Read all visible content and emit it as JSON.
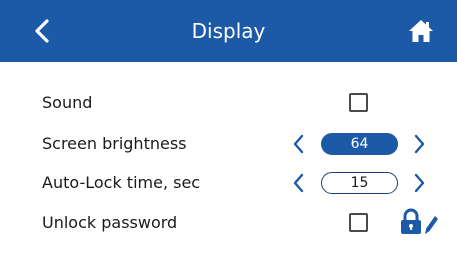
{
  "header": {
    "title": "Display",
    "back_icon": "chevron-left-icon",
    "home_icon": "home-icon"
  },
  "settings": {
    "sound": {
      "label": "Sound",
      "checked": false
    },
    "screen_brightness": {
      "label": "Screen brightness",
      "value": "64"
    },
    "auto_lock": {
      "label": "Auto-Lock time, sec",
      "value": "15"
    },
    "unlock_password": {
      "label": "Unlock password",
      "checked": false,
      "icon": "lock-edit-icon"
    }
  },
  "colors": {
    "accent": "#1c5aa8",
    "background": "#ffffff",
    "text": "#1a1a1a"
  }
}
